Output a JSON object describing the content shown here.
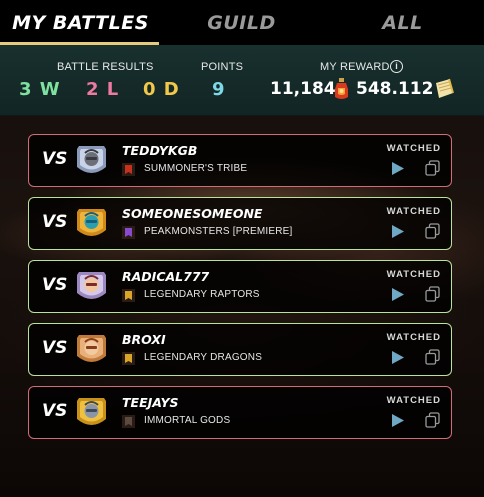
{
  "tabs": [
    {
      "label": "MY BATTLES",
      "active": true
    },
    {
      "label": "GUILD",
      "active": false
    },
    {
      "label": "ALL",
      "active": false
    }
  ],
  "summary": {
    "battle_results_label": "BATTLE RESULTS",
    "wins": "3 W",
    "losses": "2 L",
    "draws": "0 D",
    "points_label": "POINTS",
    "points": "9",
    "reward_label": "MY REWARD",
    "reward_amount": "11,184",
    "reward_secondary": "548.112",
    "info_glyph": "i"
  },
  "colors": {
    "win_border": "#b9e29a",
    "loss_border": "#d46a74",
    "wins": "#7fe0a0",
    "losses": "#ee7aa0",
    "draws": "#f0c84a",
    "points": "#7ed8e6",
    "tab_underline": "#e9c97a"
  },
  "battles": [
    {
      "vs": "VS",
      "name": "TEDDYKGB",
      "guild": "SUMMONER'S TRIBE",
      "status": "WATCHED",
      "result": "loss",
      "avatar": "robot-avatar-icon",
      "guild_icon": "red-banner-icon"
    },
    {
      "vs": "VS",
      "name": "SOMEONESOMEONE",
      "guild": "PEAKMONSTERS [PREMIERE]",
      "status": "WATCHED",
      "result": "win",
      "avatar": "helmet-avatar-icon",
      "guild_icon": "purple-banner-icon"
    },
    {
      "vs": "VS",
      "name": "RADICAL777",
      "guild": "LEGENDARY RAPTORS",
      "status": "WATCHED",
      "result": "win",
      "avatar": "pirate-avatar-icon",
      "guild_icon": "gold-banner-icon"
    },
    {
      "vs": "VS",
      "name": "BROXI",
      "guild": "LEGENDARY DRAGONS",
      "status": "WATCHED",
      "result": "win",
      "avatar": "dwarf-avatar-icon",
      "guild_icon": "gold-banner-icon"
    },
    {
      "vs": "VS",
      "name": "TEEJAYS",
      "guild": "IMMORTAL GODS",
      "status": "WATCHED",
      "result": "loss",
      "avatar": "knight-avatar-icon",
      "guild_icon": "dark-banner-icon"
    }
  ]
}
